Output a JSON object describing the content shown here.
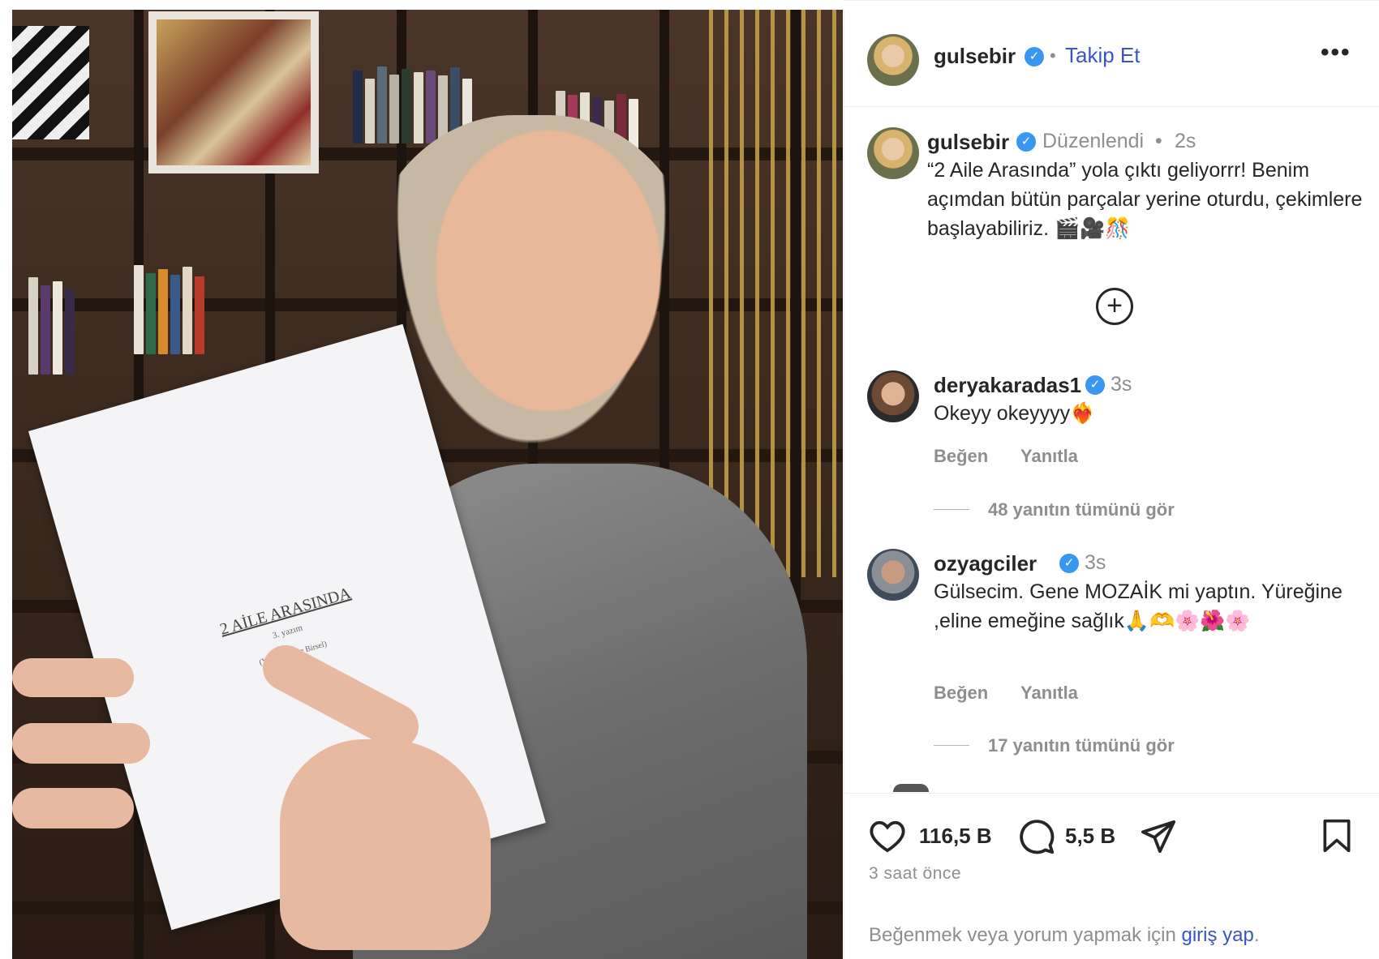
{
  "photo": {
    "paper_title": "2 AİLE ARASINDA",
    "paper_subtitle": "3. yazım",
    "paper_author": "(Yazan: Gülse Birsel)"
  },
  "header": {
    "username": "gulsebir",
    "verified_icon": "verified-badge-icon",
    "follow_label": "Takip Et",
    "more_label": "•••"
  },
  "post": {
    "username": "gulsebir",
    "edited_label": "Düzenlendi",
    "separator": "•",
    "age": "2s",
    "caption": "“2 Aile Arasında” yola çıktı geliyorrr! Benim açımdan bütün parçalar yerine oturdu, çekimlere başlayabiliriz. 🎬🎥🎊"
  },
  "comments": [
    {
      "username": "deryakaradas1",
      "age": "3s",
      "text": "Okeyy okeyyyy❤️‍🔥",
      "like_label": "Beğen",
      "reply_label": "Yanıtla",
      "replies_label": "48 yanıtın tümünü gör"
    },
    {
      "username": "ozyagciler",
      "age": "3s",
      "text": "Gülsecim. Gene MOZAİK mi yaptın. Yüreğine ,eline emeğine sağlık🙏🫶🌸🌺🌸",
      "like_label": "Beğen",
      "reply_label": "Yanıtla",
      "replies_label": "17 yanıtın tümünü gör"
    }
  ],
  "footer": {
    "like_count": "116,5 B",
    "comment_count": "5,5 B",
    "time_ago": "3 saat önce",
    "login_prefix": "Beğenmek veya yorum yapmak için ",
    "login_link": "giriş yap",
    "login_suffix": "."
  },
  "colors": {
    "link": "#3b54c9",
    "verified": "#3897f0",
    "secondary_text": "#8e8e8e",
    "primary_text": "#262626"
  }
}
